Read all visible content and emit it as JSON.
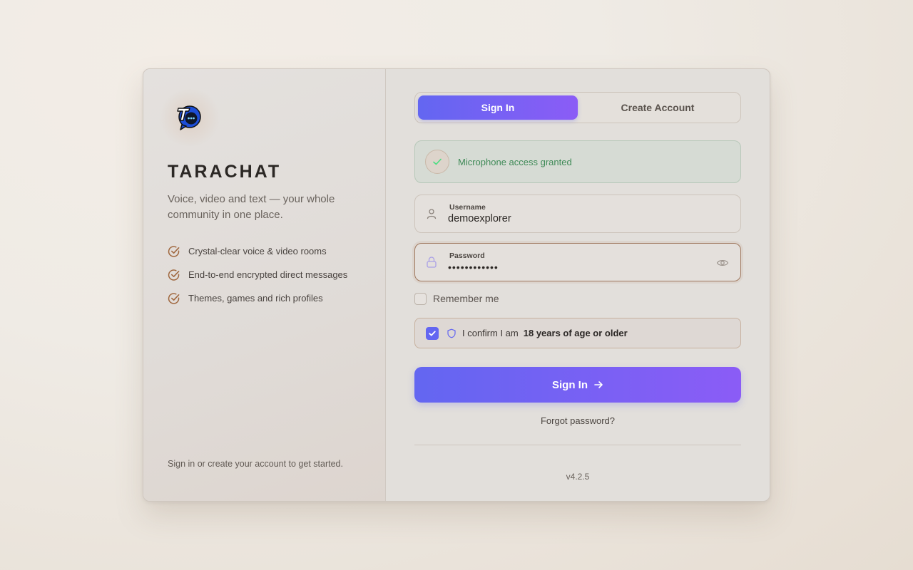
{
  "brand": {
    "name": "TARACHAT",
    "tagline": "Voice, video and text — your whole community in one place.",
    "logo_icon": "chat-bubble-logo-icon"
  },
  "features": [
    {
      "label": "Crystal-clear voice & video rooms",
      "icon": "check-circle-icon"
    },
    {
      "label": "End-to-end encrypted direct messages",
      "icon": "check-circle-icon"
    },
    {
      "label": "Themes, games and rich profiles",
      "icon": "check-circle-icon"
    }
  ],
  "footnote": "Sign in or create your account to get started.",
  "tabs": [
    {
      "label": "Sign In",
      "active": true
    },
    {
      "label": "Create Account",
      "active": false
    }
  ],
  "mic_status": {
    "text": "Microphone access granted",
    "icon": "check-icon"
  },
  "username": {
    "label": "Username",
    "value": "demoexplorer",
    "icon": "user-icon"
  },
  "password": {
    "label": "Password",
    "value": "••••••••••••",
    "icon": "lock-icon",
    "toggle_icon": "eye-icon"
  },
  "remember": {
    "label": "Remember me",
    "checked": false
  },
  "age_confirm": {
    "text": "I confirm I am",
    "bold": "18 years of age or older",
    "checked": true,
    "icon": "shield-icon"
  },
  "submit": {
    "label": "Sign In",
    "icon": "arrow-right-icon"
  },
  "forgot_label": "Forgot password?",
  "version": "v4.2.5",
  "colors": {
    "accent_start": "#6366f1",
    "accent_end": "#8b5cf6",
    "success": "#3f8a57",
    "feature_check": "#a0673e"
  }
}
